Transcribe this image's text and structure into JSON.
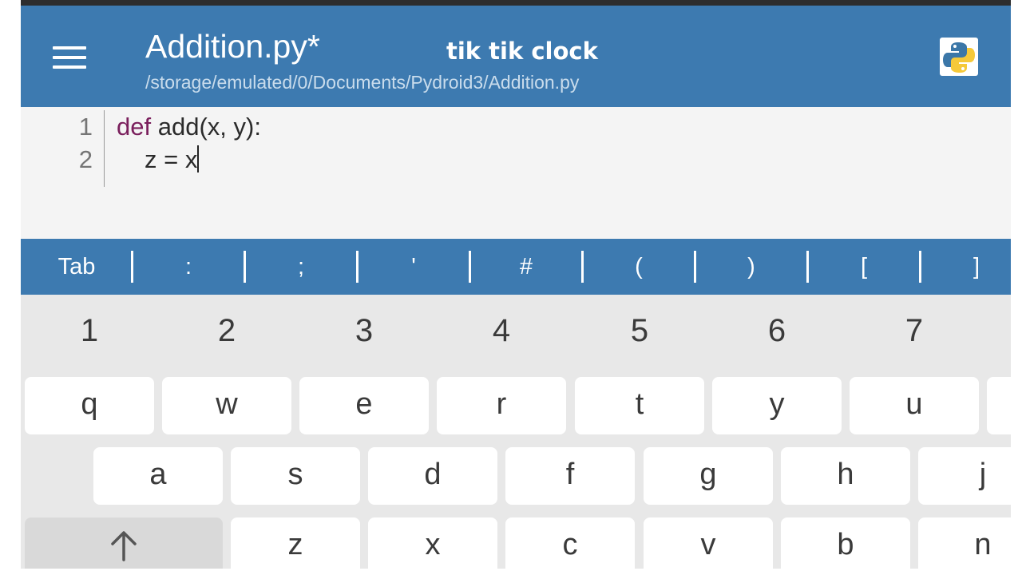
{
  "app_bar": {
    "file_title": "Addition.py*",
    "file_path": "/storage/emulated/0/Documents/Pydroid3/Addition.py",
    "watermark": "tik tik clock",
    "menu_icon": "hamburger-menu-icon",
    "app_icon": "python-logo-icon"
  },
  "editor": {
    "lines": [
      {
        "number": "1",
        "keyword": "def",
        "rest": " add(x, y):"
      },
      {
        "number": "2",
        "keyword": "",
        "rest": "z = x"
      }
    ]
  },
  "symbol_bar": {
    "keys": [
      "Tab",
      ":",
      ";",
      "'",
      "#",
      "(",
      ")",
      "[",
      "]"
    ]
  },
  "keyboard": {
    "number_row": [
      "1",
      "2",
      "3",
      "4",
      "5",
      "6",
      "7"
    ],
    "row1": [
      "q",
      "w",
      "e",
      "r",
      "t",
      "y",
      "u"
    ],
    "row2": [
      "a",
      "s",
      "d",
      "f",
      "g",
      "h",
      "j"
    ],
    "row3": [
      "z",
      "x",
      "c",
      "v",
      "b",
      "n"
    ],
    "shift_icon": "shift-arrow-icon"
  },
  "colors": {
    "app_bar": "#3d7ab0",
    "keyword": "#7a1f5c",
    "editor_bg": "#f4f4f4",
    "keyboard_bg": "#e8e8e8"
  }
}
